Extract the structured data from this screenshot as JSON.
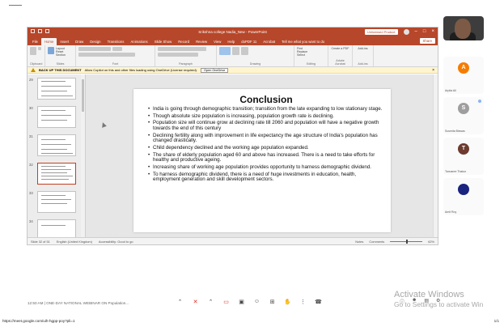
{
  "window": {
    "title": "Srikshna college Nadia_New - PowerPoint",
    "warning": "Unlicensed Product",
    "share_label": "Share"
  },
  "ribbon_tabs": [
    "File",
    "Home",
    "Insert",
    "Draw",
    "Design",
    "Transitions",
    "Animations",
    "Slide Show",
    "Record",
    "Review",
    "View",
    "Help",
    "doPDF 11",
    "Acrobat",
    "Tell me what you want to do"
  ],
  "ribbon_groups": [
    "Clipboard",
    "Slides",
    "Font",
    "Paragraph",
    "Drawing",
    "Editing",
    "Adobe Acrobat",
    "Add-ins"
  ],
  "ribbon_buttons": {
    "new_slide": "New Slide",
    "layout": "Layout",
    "reset": "Reset",
    "section": "Section",
    "shapes": "Shapes",
    "arrange": "Arrange",
    "quick_styles": "Quick Styles",
    "find": "Find",
    "replace": "Replace",
    "select": "Select",
    "create_pdf": "Create a PDF",
    "add_ins": "Add-ins"
  },
  "message_bar": {
    "title": "BACK UP THIS DOCUMENT",
    "text": "Allow Copilot on this and other files loading using OneDrive (License required).",
    "button": "Open OneDrive"
  },
  "thumbnails": [
    {
      "num": "29",
      "active": false
    },
    {
      "num": "30",
      "active": false
    },
    {
      "num": "31",
      "active": false
    },
    {
      "num": "32",
      "active": true
    },
    {
      "num": "33",
      "active": false
    },
    {
      "num": "34",
      "active": false
    }
  ],
  "slide": {
    "title": "Conclusion",
    "bullets": [
      "India is going through demographic transition; transition from the late expanding to low stationary stage.",
      "Though absolute size population is increasing, population growth rate is declining.",
      "Population size will continue grow at declining rate till 2060 and population will have a negative growth towards the end of this century",
      "Declining fertility along with improvement in life expectancy the age structure of India's population has changed drastically.",
      "Child dependency declined and the working age population expanded.",
      "The share of elderly population aged 60 and above has increased. There is a need to take efforts for healthy and productive ageing.",
      "Increasing share of working age population provides opportunity to harness demographic dividend.",
      "To harness demographic dividend, there is a need of huge investments in education, health, employment generation and skill development sectors."
    ]
  },
  "statusbar": {
    "slide_info": "Slide 32 of 51",
    "language": "English (United Kingdom)",
    "accessibility": "Accessibility: Good to go",
    "notes": "Notes",
    "comments": "Comments",
    "zoom": "62%"
  },
  "participants": [
    {
      "name": "Arpita Ali",
      "initial": "A",
      "color": "#f57c00"
    },
    {
      "name": "Susmita Biswas",
      "initial": "S",
      "color": "#9e9e9e"
    },
    {
      "name": "Tanusree Thakur",
      "initial": "T",
      "color": "#6d3b2f"
    },
    {
      "name": "Amit Roy",
      "initial": "",
      "color": "#1a237e"
    }
  ],
  "meet": {
    "info": "12:50 AM  |  ONE-DAY NATIONAL WEBINAR ON Population...",
    "activate_title": "Activate Windows",
    "activate_sub": "Go to Settings to activate Win"
  },
  "footer": {
    "url": "https://meet.google.com/uih-hgpp-poy?pli=1",
    "page": "1/1"
  }
}
